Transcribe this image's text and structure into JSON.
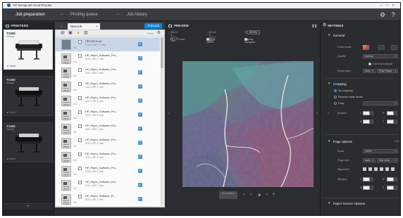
{
  "window": {
    "title": "HP DesignJet SmartTracker"
  },
  "nav": {
    "tabs": [
      {
        "label": "Job preparation"
      },
      {
        "label": "Printing queue"
      },
      {
        "label": "Job history"
      }
    ],
    "separator": ">"
  },
  "printers": {
    "header": "PRINTERS",
    "items": [
      {
        "name": "T1300",
        "status": "Ready",
        "link": "More"
      },
      {
        "name": "T1300",
        "status": "Ready",
        "link": "More"
      },
      {
        "name": "T1300",
        "status": "Ready",
        "link": "More"
      }
    ],
    "add_label": "+"
  },
  "joblist": {
    "home_icon": "home-icon",
    "tab_label": "New job",
    "print_button": "Print job",
    "filter_label": "Filter",
    "rows": [
      {
        "name": "HP0-RG7mdt",
        "size": "914.4 x 677.7 mm",
        "copies": "1/1"
      },
      {
        "name": "HP_Repro_Software_Pro...",
        "size": "210 x 297.1 mm",
        "copies": "1/1"
      },
      {
        "name": "HP_Repro_Software_Pro...",
        "size": "210 x 297.1 mm",
        "copies": "1/1"
      },
      {
        "name": "HP_Repro_Software_Pro...",
        "size": "210 x 297.1 mm",
        "copies": "1/1"
      },
      {
        "name": "HP_Repro_Software_Pro...",
        "size": "210 x 297.1 mm",
        "copies": "1/1"
      },
      {
        "name": "HP_Repro_Software_Pro...",
        "size": "210 x 297.1 mm",
        "copies": "1/1"
      },
      {
        "name": "HP_Repro_Software_Pro...",
        "size": "210 x 297.1 mm",
        "copies": "1/1"
      },
      {
        "name": "HP_Repro_Software_Pro...",
        "size": "210 x 297.1 mm",
        "copies": "1/1"
      },
      {
        "name": "HP_Repro_Software_Pro...",
        "size": "210 x 297.1 mm",
        "copies": "1/1"
      },
      {
        "name": "HP_Repro_Software_Pro...",
        "size": "210 x 297.1 mm",
        "copies": "1/1"
      },
      {
        "name": "HP_Repro_Software_Pro...",
        "size": "210 x 297.1 mm",
        "copies": "1/1"
      },
      {
        "name": "HP_Repro_Software_Pr...",
        "size": "210 x 297.1 mm",
        "copies": "1/1"
      }
    ]
  },
  "preview": {
    "header": "PREVIEW",
    "dims_a": "914.4 x 677.7 mm",
    "dims_b": "914.4 x 677.7 mm",
    "zoom": "32.9%",
    "scale": "8.0 / 2.5 mm",
    "opt_display_rulers": "Display rulers",
    "opt_display_navigator": "Display navigator",
    "fit_label": "Fit to window"
  },
  "settings": {
    "header": "SETTINGS",
    "general": {
      "title": "General",
      "color_mode_label": "Color mode",
      "quality_label": "Quality",
      "quality_value": "Normal",
      "economode_label": "Use EconoMode",
      "paper_type_label": "Paper type",
      "paper_source_value": "Auto",
      "paper_type_value": "Plain Paper"
    },
    "cropping": {
      "title": "Cropping",
      "opt_none": "No cropping",
      "opt_remove_white": "Remove white areas",
      "opt_crop": "Crop",
      "borders_label": "Borders"
    },
    "page_options": {
      "title": "Page options",
      "link": "Edit",
      "scale_label": "Scale",
      "scale_value": "100%",
      "page_size_label": "Page size",
      "page_size_auto": "Auto",
      "page_size_value": "Sim Leta...",
      "alignment_label": "Alignment",
      "margins_label": "Margins"
    },
    "paper_source": {
      "title": "Paper Source Options"
    }
  }
}
